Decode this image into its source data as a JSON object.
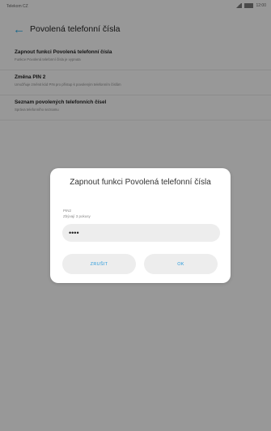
{
  "statusbar": {
    "carrier": "Telekom CZ",
    "right_text": "12:00"
  },
  "appbar": {
    "title": "Povolená telefonní čísla",
    "back_icon": "back-arrow-icon"
  },
  "list": [
    {
      "title": "Zapnout funkci Povolená telefonní čísla",
      "subtitle": "Funkce Povolená telefonní čísla je vypnuta"
    },
    {
      "title": "Změna PIN 2",
      "subtitle": "Umožňuje změnit kód PIN pro přístup k povoleným telefonním číslům"
    },
    {
      "title": "Seznam povolených telefonních čísel",
      "subtitle": "Správa telefonního seznamu"
    }
  ],
  "dialog": {
    "title": "Zapnout funkci Povolená telefonní čísla",
    "field_label": "PIN2",
    "field_hint": "Zbývají 3 pokusy",
    "field_value": "••••",
    "cancel": "ZRUŠIT",
    "ok": "OK"
  },
  "colors": {
    "accent": "#2aa7df",
    "dim_overlay": "rgba(0,0,0,0.38)"
  }
}
